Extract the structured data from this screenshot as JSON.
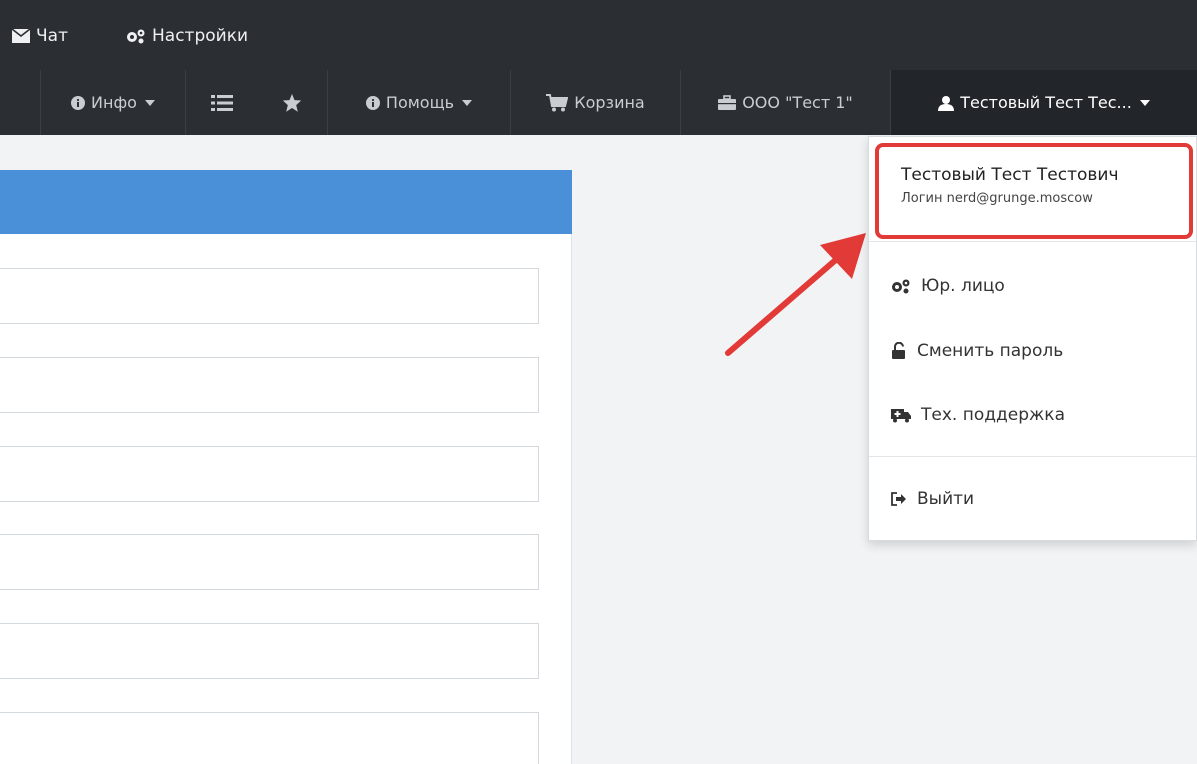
{
  "top_bar": {
    "chat_label": "Чат",
    "settings_label": "Настройки"
  },
  "nav": {
    "info_label": "Инфо",
    "help_label": "Помощь",
    "cart_label": "Корзина",
    "company_label": "ООО \"Тест 1\"",
    "user_label": "Тестовый Тест Тес..."
  },
  "dropdown": {
    "user_name": "Тестовый Тест Тестович",
    "user_login": "Логин nerd@grunge.moscow",
    "items": [
      {
        "label": "Юр. лицо",
        "icon": "cogs-icon"
      },
      {
        "label": "Сменить пароль",
        "icon": "unlock-icon"
      },
      {
        "label": "Тех. поддержка",
        "icon": "ambulance-icon"
      },
      {
        "label": "Выйти",
        "icon": "sign-out-icon"
      }
    ]
  },
  "colors": {
    "topbar": "#2b2f33",
    "panel_header": "#4a90d9",
    "highlight": "#e23a36"
  }
}
